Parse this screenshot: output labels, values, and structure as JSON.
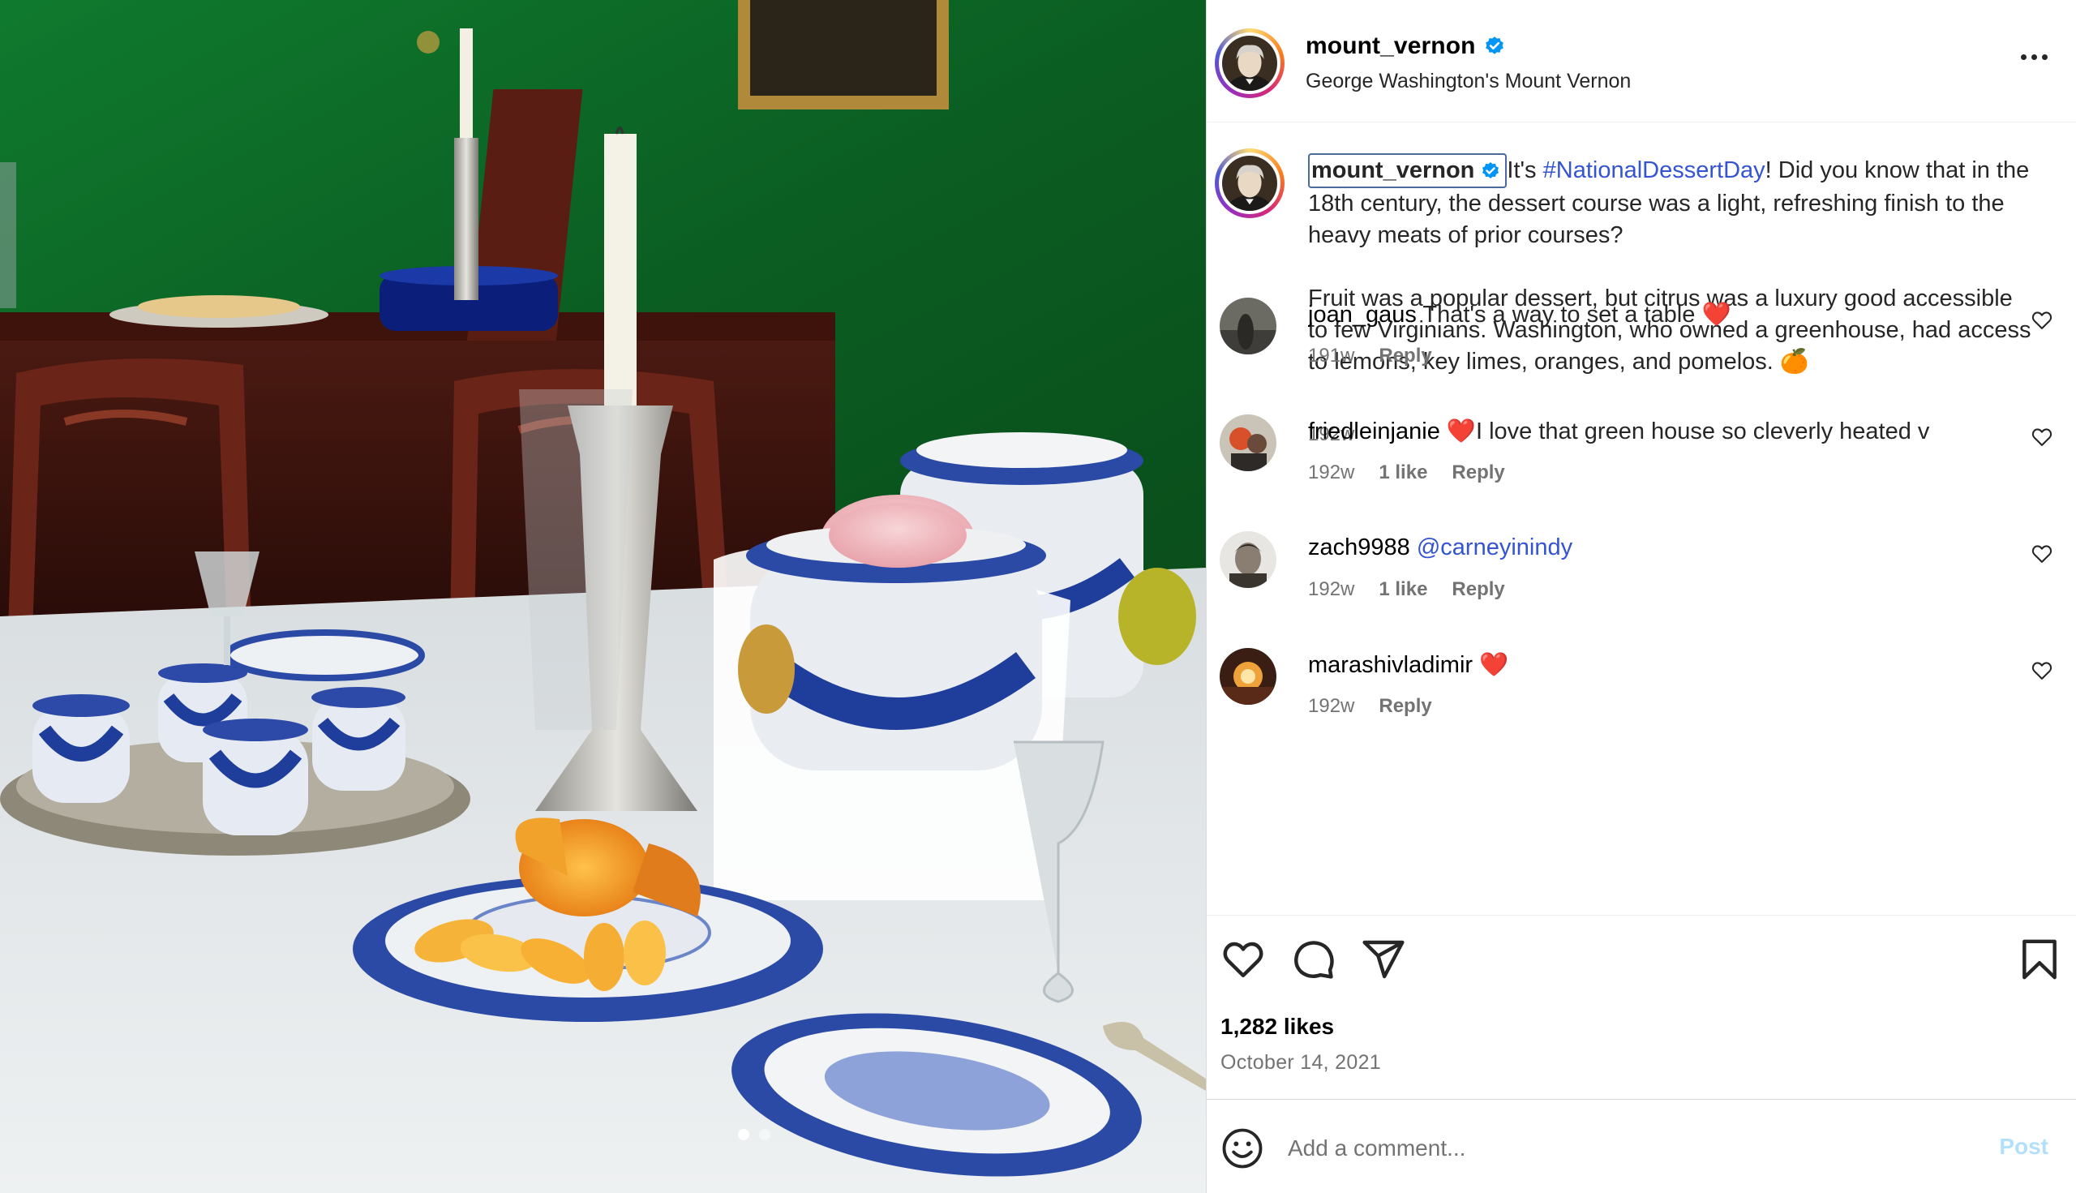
{
  "post": {
    "username": "mount_vernon",
    "subtitle": "George Washington's Mount Vernon",
    "verified": true
  },
  "caption": {
    "username": "mount_vernon",
    "text_pre": "It's ",
    "hashtag": "#NationalDessertDay",
    "text_post": "! Did you know that in the 18th century, the dessert course was a light, refreshing finish to the heavy meats of prior courses?",
    "paragraph2": "Fruit was a popular dessert, but citrus was a luxury good accessible to few Virginians. Washington, who owned a greenhouse, had access to lemons, key limes, oranges, and pomelos. 🍊",
    "time": "192w"
  },
  "comments": [
    {
      "user": "joan_gaus",
      "text": "That's a way to set a table ❤️",
      "time": "191w",
      "likes": "",
      "reply": "Reply"
    },
    {
      "user": "friedleinjanie",
      "text": "❤️I love that green house so cleverly heated v",
      "time": "192w",
      "likes": "1 like",
      "reply": "Reply"
    },
    {
      "user": "zach9988",
      "text": "",
      "mention": "@carneyinindy",
      "time": "192w",
      "likes": "1 like",
      "reply": "Reply"
    },
    {
      "user": "marashivladimir",
      "text": "❤️",
      "time": "192w",
      "likes": "",
      "reply": "Reply"
    }
  ],
  "actions": {
    "icons": [
      "heart-icon",
      "comment-icon",
      "share-icon",
      "bookmark-icon"
    ]
  },
  "stats": {
    "likes": "1,282 likes",
    "date": "October 14, 2021"
  },
  "composer": {
    "placeholder": "Add a comment...",
    "post_label": "Post"
  },
  "colors": {
    "link": "#3454d1",
    "verified": "#0095f6",
    "meta": "#737373",
    "post_disabled": "#b2dffc",
    "wall_green": "#0f6b2a"
  }
}
